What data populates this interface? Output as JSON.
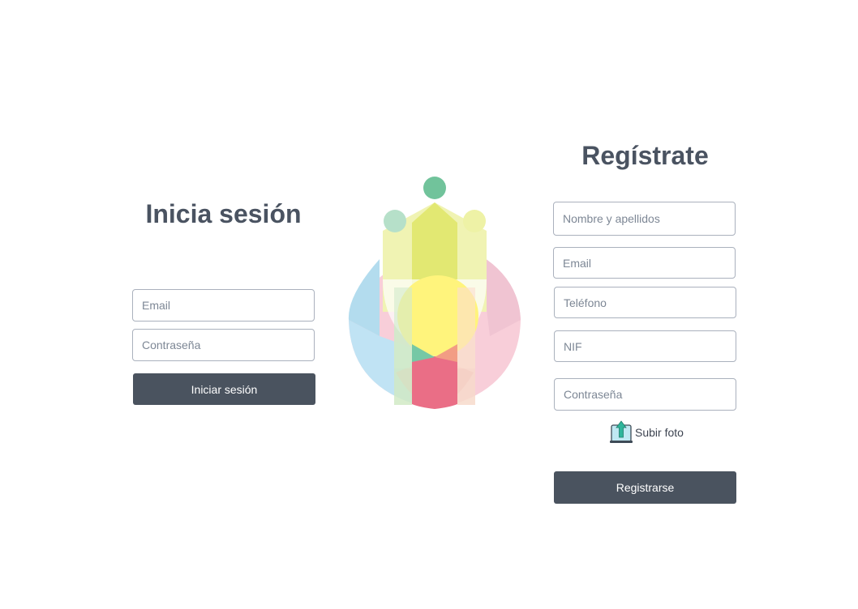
{
  "login": {
    "title": "Inicia sesión",
    "email_placeholder": "Email",
    "password_placeholder": "Contraseña",
    "submit_label": "Iniciar sesión"
  },
  "register": {
    "title": "Regístrate",
    "name_placeholder": "Nombre y apellidos",
    "email_placeholder": "Email",
    "phone_placeholder": "Teléfono",
    "nif_placeholder": "NIF",
    "password_placeholder": "Contraseña",
    "upload_label": "Subir foto",
    "upload_icon": "upload-icon",
    "submit_label": "Registrarse"
  },
  "logo": {
    "icon": "community-logo"
  },
  "colors": {
    "text": "#4a5361",
    "button": "#4a535f",
    "field_border": "#aab1bd"
  }
}
